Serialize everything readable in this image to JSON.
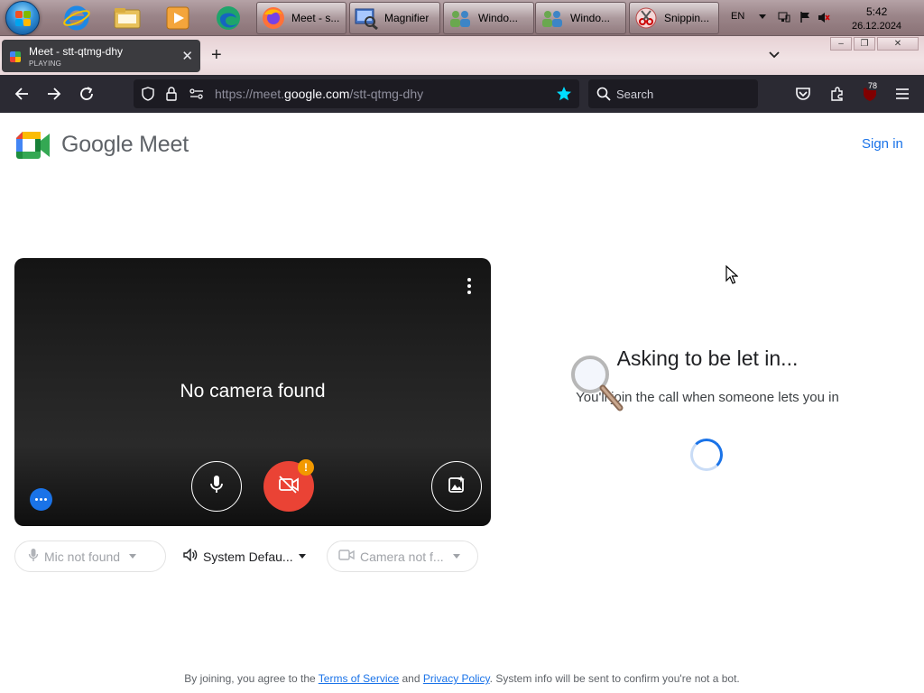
{
  "taskbar": {
    "start_label": "Start",
    "pinned": [
      {
        "name": "internet-explorer-icon"
      },
      {
        "name": "file-explorer-icon"
      },
      {
        "name": "media-player-icon"
      },
      {
        "name": "edge-icon"
      }
    ],
    "windows": [
      {
        "label": "Meet - s...",
        "icon": "firefox-icon"
      },
      {
        "label": "Magnifier",
        "icon": "magnifier-app-icon"
      },
      {
        "label": "Windo...",
        "icon": "windows-app-icon"
      },
      {
        "label": "Windo...",
        "icon": "windows-app-icon"
      },
      {
        "label": "Snippin...",
        "icon": "snipping-tool-icon"
      }
    ],
    "tray": {
      "language": "EN",
      "time": "5:42",
      "date": "26.12.2024"
    }
  },
  "browser": {
    "tab": {
      "title": "Meet - stt-qtmg-dhy",
      "status": "PLAYING"
    },
    "url": {
      "prefix": "https://meet.",
      "domain": "google.com",
      "path": "/stt-qtmg-dhy"
    },
    "search_placeholder": "Search",
    "extension_badge": "78",
    "window_controls": {
      "minimize": "–",
      "restore": "❐",
      "close": "✕"
    }
  },
  "meet": {
    "brand": "Google Meet",
    "sign_in": "Sign in",
    "preview": {
      "no_camera": "No camera found",
      "camera_warning": "!"
    },
    "devices": {
      "mic": "Mic not found",
      "speaker": "System Defau...",
      "camera": "Camera not f..."
    },
    "status": {
      "title": "Asking to be let in...",
      "subtitle": "You'll join the call when someone lets you in"
    },
    "footer": {
      "prefix": "By joining, you agree to the ",
      "terms": "Terms of Service",
      "and": " and ",
      "privacy": "Privacy Policy",
      "suffix": ". System info will be sent to confirm you're not a bot."
    }
  },
  "colors": {
    "accent": "#1a73e8",
    "danger": "#ea4335",
    "warning": "#f29900",
    "toolbar": "#2b2a33"
  }
}
